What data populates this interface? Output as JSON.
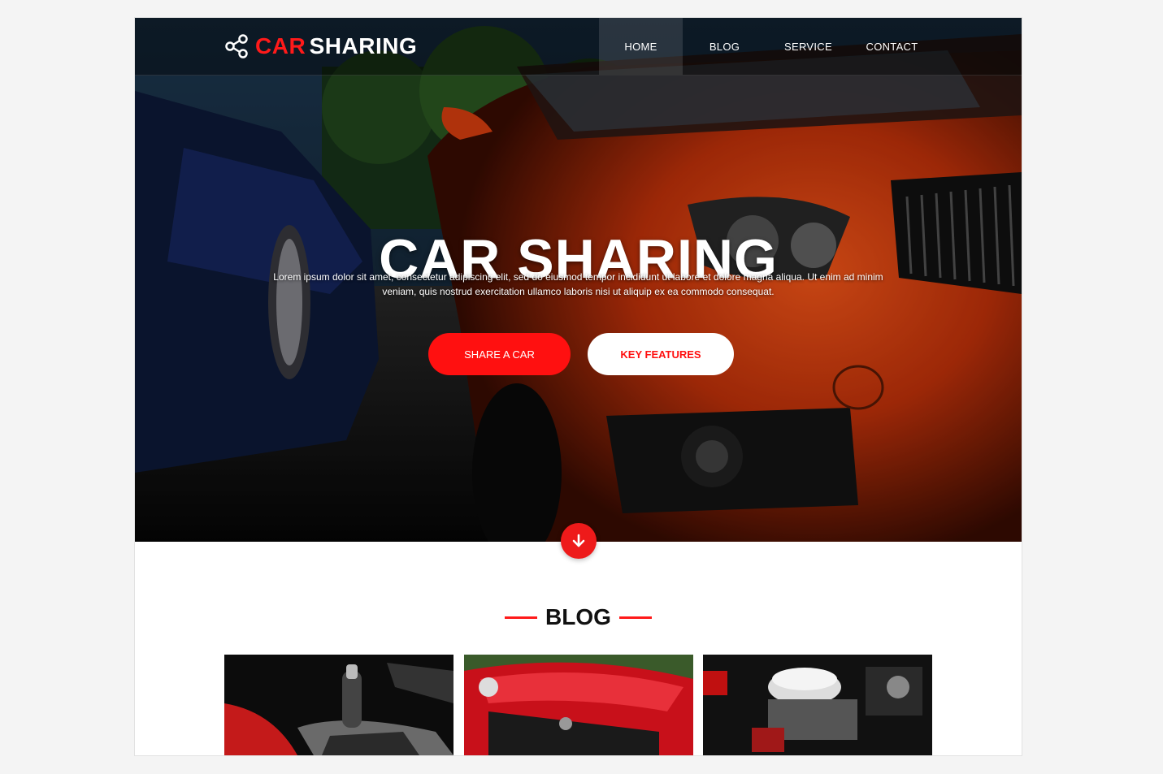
{
  "brand": {
    "name_accent": "CAR",
    "name_rest": "SHARING",
    "accent_color": "#ff1a1a"
  },
  "nav": {
    "items": [
      {
        "label": "HOME"
      },
      {
        "label": "BLOG"
      },
      {
        "label": "SERVICE"
      },
      {
        "label": "CONTACT"
      }
    ],
    "active_index": 0
  },
  "hero": {
    "title": "CAR SHARING",
    "text_line1": "Lorem ipsum dolor sit amet, consectetur adipiscing elit, sed do eiusmod tempor incididunt ut labore et dolore magna aliqua. Ut enim ad minim",
    "text_line2": "veniam, quis nostrud exercitation ullamco laboris nisi ut aliquip ex ea commodo consequat.",
    "primary_button": "SHARE A CAR",
    "secondary_button": "KEY FEATURES",
    "scroll_icon": "arrow-down-icon"
  },
  "blog": {
    "title": "BLOG",
    "cards": [
      {
        "image": "gear-shifter-photo"
      },
      {
        "image": "red-mustang-photo"
      },
      {
        "image": "engine-bay-photo"
      }
    ]
  }
}
